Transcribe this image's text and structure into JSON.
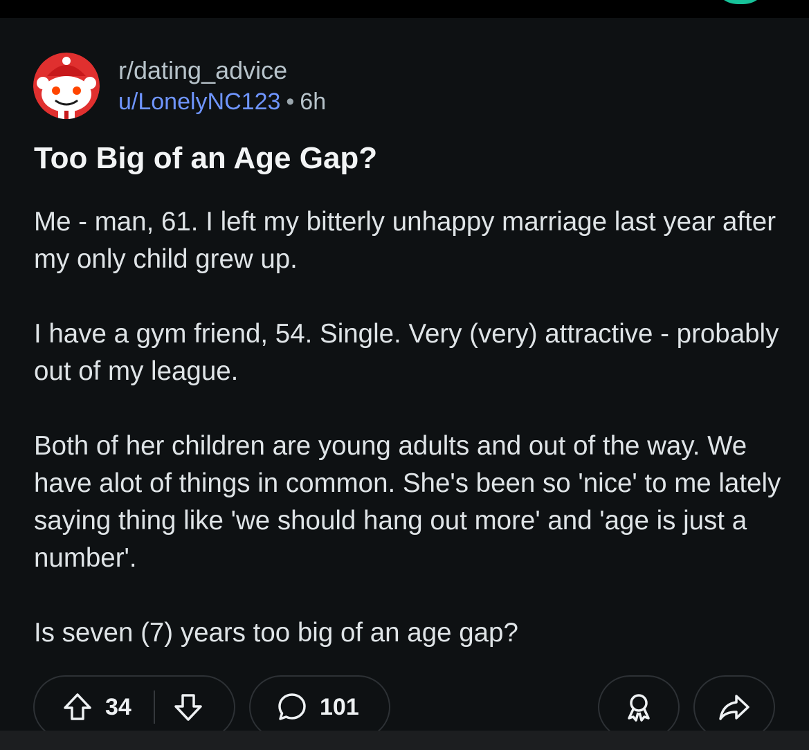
{
  "post": {
    "subreddit": "r/dating_advice",
    "username": "u/LonelyNC123",
    "separator": "•",
    "time_ago": "6h",
    "title": "Too Big of an Age Gap?",
    "body": [
      "Me - man, 61.  I left my bitterly unhappy marriage last year after my only child grew up.",
      "I have a gym friend, 54.  Single.  Very (very) attractive - probably out of my league.",
      "Both of her children are young adults and out of the way.  We have alot of things in common.  She's been so 'nice' to me lately saying thing like 'we should hang out more' and 'age is just a number'.",
      "Is seven (7) years too big of an age gap?"
    ]
  },
  "actions": {
    "upvote_icon": "arrow-up-icon",
    "downvote_icon": "arrow-down-icon",
    "score": "34",
    "comment_icon": "speech-bubble-icon",
    "comments": "101",
    "award_icon": "award-icon",
    "share_icon": "share-arrow-icon"
  },
  "colors": {
    "background": "#0e1113",
    "subreddit_text": "#b7c3ca",
    "username_text": "#6f95ff",
    "title_text": "#f2f4f5",
    "body_text": "#dfe4e7",
    "pill_border": "#2d3135",
    "avatar_red": "#e0302f"
  }
}
